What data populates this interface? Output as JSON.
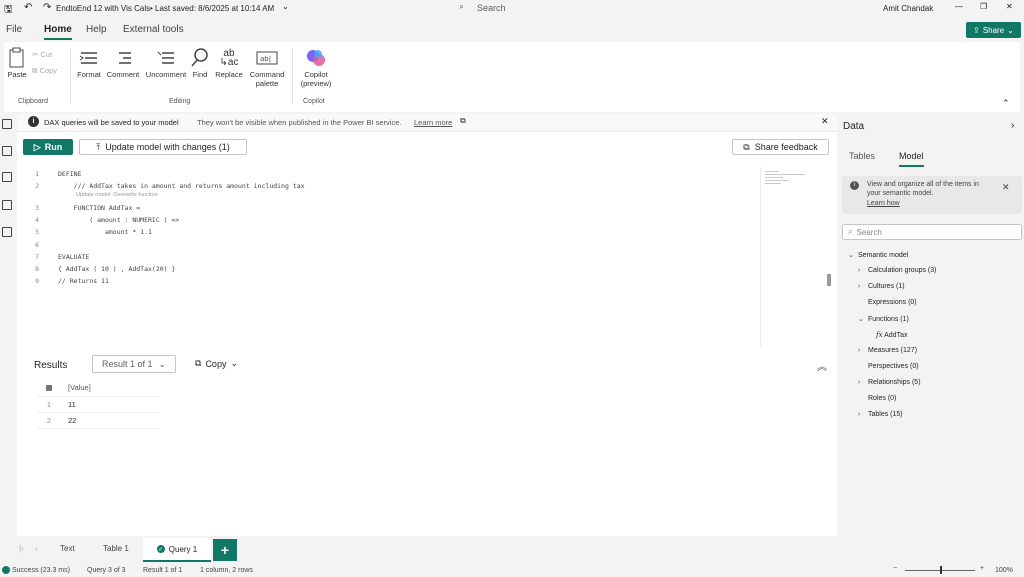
{
  "titlebar": {
    "title": "EndtoEnd 12 with Vis Cals",
    "saved": "• Last saved: 8/6/2025 at 10:14 AM",
    "search_placeholder": "Search",
    "user": "Amit Chandak"
  },
  "menu": {
    "tabs": [
      "File",
      "Home",
      "Help",
      "External tools"
    ],
    "share_label": "Share"
  },
  "ribbon": {
    "paste": "Paste",
    "cut": "Cut",
    "copy": "Copy",
    "clipboard_group": "Clipboard",
    "format": "Format",
    "comment": "Comment",
    "uncomment": "Uncomment",
    "find": "Find",
    "replace": "Replace",
    "command_palette_1": "Command",
    "command_palette_2": "palette",
    "editing_group": "Editing",
    "copilot_1": "Copilot",
    "copilot_2": "(preview)",
    "copilot_group": "Copilot"
  },
  "infobar": {
    "bold": "DAX queries will be saved to your model",
    "text": "They won't be visible when published in the Power BI service.",
    "link": "Learn more"
  },
  "toolbar": {
    "run": "Run",
    "update": "Update model with changes (1)",
    "feedback": "Share feedback"
  },
  "editor": {
    "lines": [
      {
        "n": "1",
        "code": "DEFINE"
      },
      {
        "n": "2",
        "code": "    /// AddTax takes in amount and returns amount including tax"
      },
      {
        "n": "3",
        "code": "    FUNCTION AddTax ="
      },
      {
        "n": "4",
        "code": "        ( amount : NUMERIC ) =>"
      },
      {
        "n": "5",
        "code": "            amount * 1.1"
      },
      {
        "n": "6",
        "code": ""
      },
      {
        "n": "7",
        "code": "EVALUATE"
      },
      {
        "n": "8",
        "code": "{ AddTax ( 10 ) , AddTax(20) }"
      },
      {
        "n": "9",
        "code": "// Returns 11"
      }
    ],
    "hint": "Update model: Overwrite function"
  },
  "results": {
    "title": "Results",
    "selector": "Result 1 of 1",
    "copy": "Copy",
    "column": "[Value]",
    "rows": [
      {
        "n": "1",
        "value": "11"
      },
      {
        "n": "2",
        "value": "22"
      }
    ]
  },
  "bottomtabs": {
    "tab1": "Text",
    "tab2": "Table 1",
    "tab3": "Query 1"
  },
  "status": {
    "success": "Success (23.3 ms)",
    "query": "Query 3 of 3",
    "result": "Result 1 of 1",
    "shape": "1 column, 2 rows",
    "zoom": "100%"
  },
  "datapane": {
    "title": "Data",
    "tab_tables": "Tables",
    "tab_model": "Model",
    "info_text": "View and organize all of the items in your semantic model.",
    "info_link": "Learn how",
    "search_placeholder": "Search",
    "tree": {
      "root": "Semantic model",
      "items": [
        {
          "label": "Calculation groups (3)"
        },
        {
          "label": "Cultures (1)"
        },
        {
          "label": "Expressions (0)"
        },
        {
          "label": "Functions (1)"
        },
        {
          "label": "AddTax"
        },
        {
          "label": "Measures (127)"
        },
        {
          "label": "Perspectives (0)"
        },
        {
          "label": "Relationships (5)"
        },
        {
          "label": "Roles (0)"
        },
        {
          "label": "Tables (15)"
        }
      ]
    }
  },
  "colors": {
    "accent": "#117865",
    "copilot": "#7b61ff"
  }
}
